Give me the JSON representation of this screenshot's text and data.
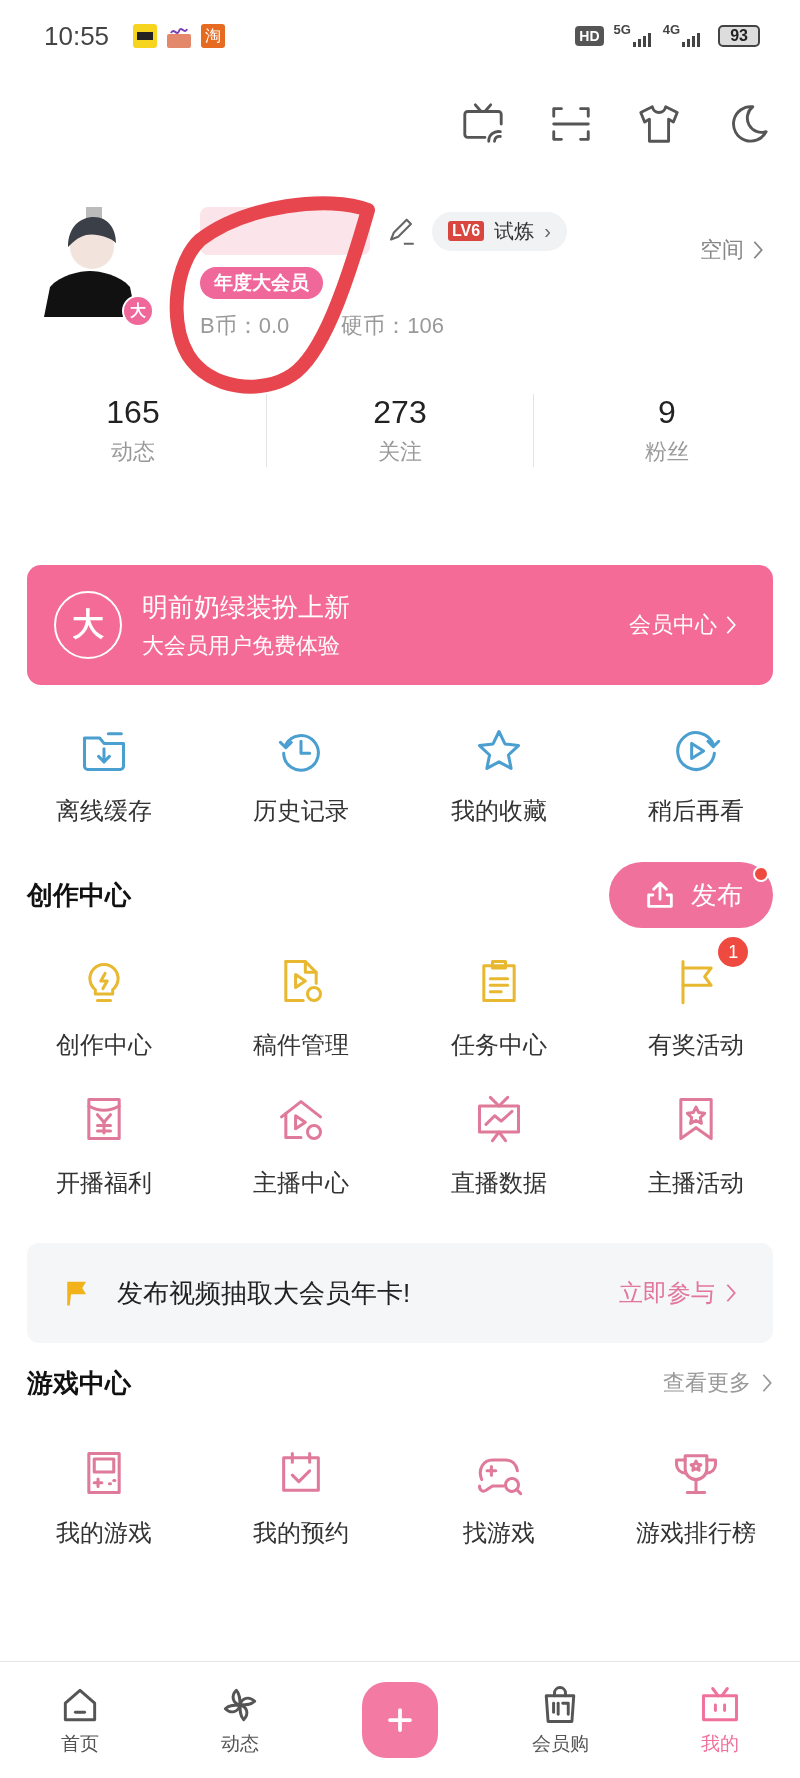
{
  "status_bar": {
    "time": "10:55",
    "app_badge": "淘",
    "hd": "HD",
    "networks": [
      "5G",
      "4G"
    ],
    "battery": "93"
  },
  "profile": {
    "vip_tag": "年度大会员",
    "avatar_badge": "大",
    "level": "LV6",
    "trial": "试炼",
    "trial_chevron": "›",
    "space_link": "空间",
    "coins": [
      "B币：0.0",
      "硬币：106"
    ]
  },
  "stats": [
    {
      "value": "165",
      "label": "动态"
    },
    {
      "value": "273",
      "label": "关注"
    },
    {
      "value": "9",
      "label": "粉丝"
    }
  ],
  "vip_banner": {
    "badge": "大",
    "title": "明前奶绿装扮上新",
    "subtitle": "大会员用户免费体验",
    "link": "会员中心"
  },
  "quick_actions": [
    {
      "label": "离线缓存"
    },
    {
      "label": "历史记录"
    },
    {
      "label": "我的收藏"
    },
    {
      "label": "稍后再看"
    }
  ],
  "creation": {
    "title": "创作中心",
    "publish_button": "发布",
    "publish_dot": true,
    "items": [
      {
        "label": "创作中心"
      },
      {
        "label": "稿件管理"
      },
      {
        "label": "任务中心"
      },
      {
        "label": "有奖活动",
        "badge": "1"
      },
      {
        "label": "开播福利"
      },
      {
        "label": "主播中心"
      },
      {
        "label": "直播数据"
      },
      {
        "label": "主播活动"
      }
    ]
  },
  "promo": {
    "text": "发布视频抽取大会员年卡!",
    "link": "立即参与"
  },
  "game_center": {
    "title": "游戏中心",
    "more": "查看更多",
    "items": [
      {
        "label": "我的游戏"
      },
      {
        "label": "我的预约"
      },
      {
        "label": "找游戏"
      },
      {
        "label": "游戏排行榜"
      }
    ]
  },
  "tab_bar": [
    {
      "kind": "tab",
      "label": "首页",
      "selected": false
    },
    {
      "kind": "tab",
      "label": "动态",
      "selected": false
    },
    {
      "kind": "create",
      "selected": false
    },
    {
      "kind": "tab",
      "label": "会员购",
      "selected": false
    },
    {
      "kind": "tab",
      "label": "我的",
      "selected": true
    }
  ]
}
